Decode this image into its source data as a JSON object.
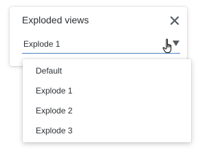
{
  "panel": {
    "title": "Exploded views",
    "close_icon": "close-icon",
    "select": {
      "value": "Explode 1",
      "caret_icon": "caret-down-icon"
    }
  },
  "dropdown": {
    "options": [
      {
        "label": "Default"
      },
      {
        "label": "Explode 1"
      },
      {
        "label": "Explode 2"
      },
      {
        "label": "Explode 3"
      }
    ]
  },
  "colors": {
    "text": "#2b2f33",
    "underline_accent": "#4a7fc1",
    "close_icon": "#555b61",
    "caret": "#555b61"
  }
}
